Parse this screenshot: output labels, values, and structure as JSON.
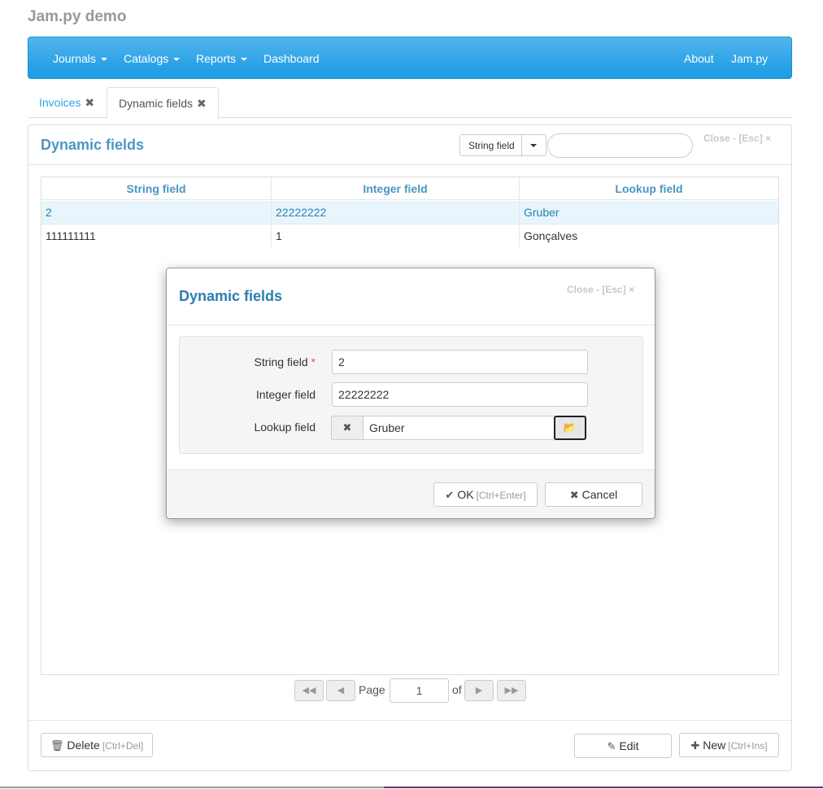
{
  "app": {
    "title": "Jam.py demo"
  },
  "navbar": {
    "left": [
      {
        "label": "Journals",
        "dropdown": true
      },
      {
        "label": "Catalogs",
        "dropdown": true
      },
      {
        "label": "Reports",
        "dropdown": true
      },
      {
        "label": "Dashboard",
        "dropdown": false
      }
    ],
    "right": [
      {
        "label": "About"
      },
      {
        "label": "Jam.py"
      }
    ],
    "color": "#2fa4e7"
  },
  "tabs": [
    {
      "label": "Invoices",
      "close": "✖",
      "active": false
    },
    {
      "label": "Dynamic fields",
      "close": "✖",
      "active": true
    }
  ],
  "panel": {
    "title": "Dynamic fields",
    "close_label": "Close - [Esc] ×",
    "search": {
      "field_label": "String field",
      "value": ""
    }
  },
  "grid": {
    "columns": [
      "String field",
      "Integer field",
      "Lookup field"
    ],
    "rows": [
      {
        "string": "2",
        "integer": "22222222",
        "lookup": "Gruber",
        "selected": true
      },
      {
        "string": "111111111",
        "integer": "1",
        "lookup": "Gonçalves",
        "selected": false
      }
    ]
  },
  "pager": {
    "page_label": "Page",
    "page_value": "1",
    "of_label": "of"
  },
  "footer": {
    "delete": {
      "label": "Delete",
      "shortcut": "[Ctrl+Del]",
      "icon": "trash-icon"
    },
    "edit": {
      "label": "Edit",
      "icon": "edit-icon"
    },
    "new": {
      "label": "New",
      "shortcut": "[Ctrl+Ins]",
      "icon": "plus-icon"
    }
  },
  "modal": {
    "title": "Dynamic fields",
    "close_label": "Close - [Esc] ×",
    "fields": {
      "string": {
        "label": "String field",
        "required_mark": "*",
        "value": "2"
      },
      "integer": {
        "label": "Integer field",
        "value": "22222222"
      },
      "lookup": {
        "label": "Lookup field",
        "value": "Gruber",
        "clear_icon": "remove-circle-icon",
        "browse_icon": "folder-open-icon"
      }
    },
    "ok": {
      "label": "OK",
      "shortcut": "[Ctrl+Enter]",
      "icon": "check-icon"
    },
    "cancel": {
      "label": "Cancel",
      "icon": "close-icon"
    }
  }
}
